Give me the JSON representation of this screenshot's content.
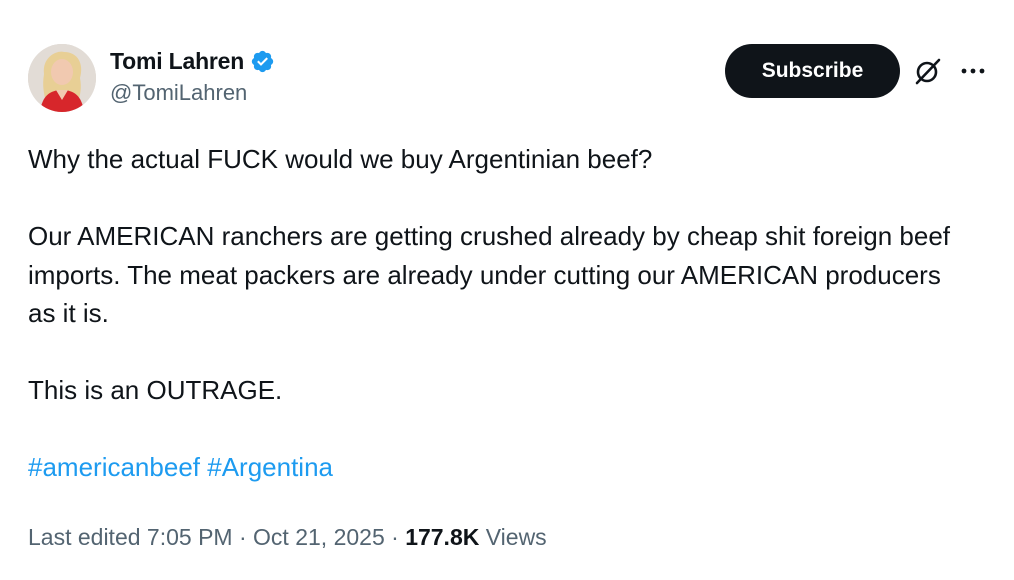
{
  "author": {
    "display_name": "Tomi Lahren",
    "handle": "@TomiLahren",
    "verified": true,
    "avatar_icon": "avatar-photo"
  },
  "actions": {
    "subscribe_label": "Subscribe",
    "grok_icon": "grok-icon",
    "more_icon": "more-icon"
  },
  "tweet": {
    "paragraphs": [
      "Why the actual FUCK would we buy Argentinian beef?",
      "Our AMERICAN ranchers are getting crushed already by cheap shit foreign beef imports. The meat packers are already under cutting our AMERICAN producers as it is.",
      "This is an OUTRAGE."
    ],
    "hashtags": [
      "#americanbeef",
      "#Argentina"
    ]
  },
  "meta": {
    "edited_label": "Last edited",
    "time": "7:05 PM",
    "separator": "·",
    "date": "Oct 21, 2025",
    "views_count": "177.8K",
    "views_label": "Views"
  },
  "colors": {
    "text": "#0f1419",
    "secondary": "#536471",
    "link": "#1d9bf0",
    "verified": "#1d9bf0",
    "button": "#0f1419"
  }
}
